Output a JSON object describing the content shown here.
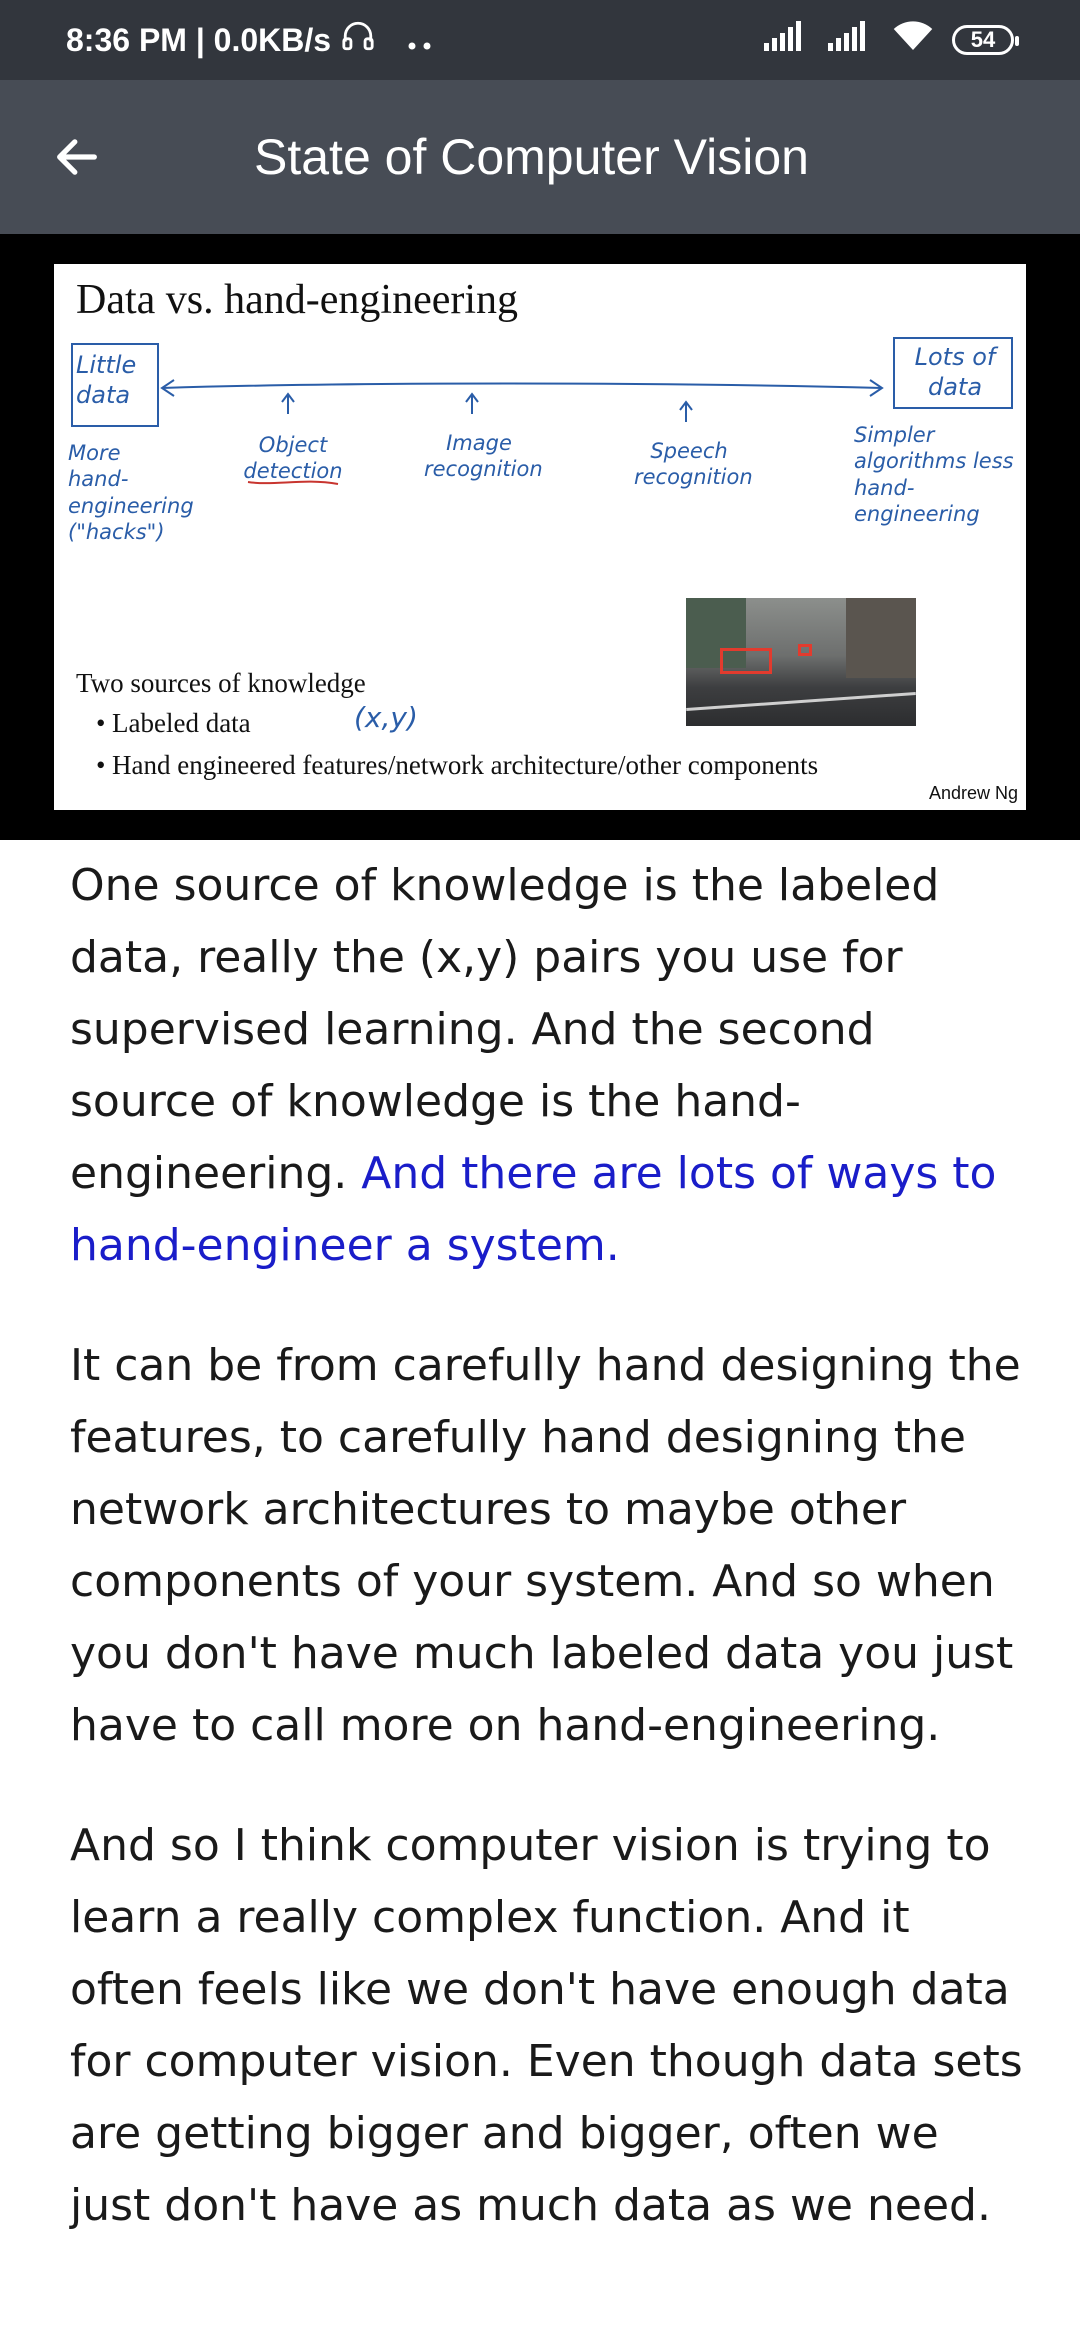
{
  "status_bar": {
    "time_speed": "8:36 PM | 0.0KB/s",
    "battery": "54"
  },
  "app_bar": {
    "title": "State of Computer Vision"
  },
  "slide": {
    "title": "Data vs. hand-engineering",
    "left_box": "Little data",
    "left_note": "More hand-engineering (\"hacks\")",
    "right_box": "Lots of data",
    "right_note": "Simpler algorithms less hand-engineering",
    "tasks": [
      "Object detection",
      "Image recognition",
      "Speech recognition"
    ],
    "sources_title": "Two sources of knowledge",
    "bullets": [
      "Labeled data",
      "Hand engineered features/network architecture/other components"
    ],
    "xy_note": "(x,y)",
    "author": "Andrew Ng"
  },
  "article": {
    "p1_normal": "One source of knowledge is the labeled data, really the (x,y) pairs you use for supervised learning. And the second source of knowledge is the hand-engineering. ",
    "p1_highlight": "And there are lots of ways to hand-engineer a system.",
    "p2": "It can be from carefully hand designing the features, to carefully hand designing the network architectures to maybe other components of your system. And so when you don't have much labeled data you just have to call more on hand-engineering.",
    "p3": "And so I think computer vision is trying to learn a really complex function. And it often feels like we don't have enough data for computer vision. Even though data sets are getting bigger and bigger, often we just don't have as much data as we need."
  }
}
